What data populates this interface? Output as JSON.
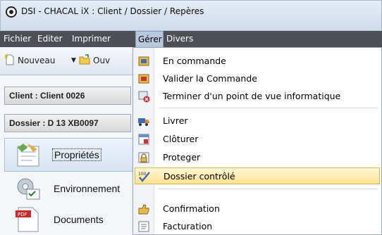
{
  "window": {
    "title": "DSI - CHACAL iX : Client / Dossier / Repères"
  },
  "menubar": {
    "items": [
      {
        "label": "Fichier"
      },
      {
        "label": "Editer"
      },
      {
        "label": "Imprimer"
      },
      {
        "label": "Gérer"
      },
      {
        "label": "Divers"
      }
    ],
    "active": "Gérer"
  },
  "toolbar": {
    "new_label": "Nouveau",
    "open_label": "Ouv"
  },
  "left": {
    "client_label": "Client : Client 0026",
    "dossier_label": "Dossier : D 13 XB0097",
    "nav": [
      {
        "label": "Propriétés",
        "icon": "properties-icon",
        "selected": true
      },
      {
        "label": "Environnement",
        "icon": "environment-icon"
      },
      {
        "label": "Documents",
        "icon": "pdf-document-icon"
      }
    ]
  },
  "dropdown": {
    "items": [
      {
        "label": "En commande",
        "icon": "order-icon"
      },
      {
        "label": "Valider la Commande",
        "icon": "validate-order-icon"
      },
      {
        "label": "Terminer d'un point de vue informatique",
        "icon": "finish-it-icon"
      },
      {
        "label": "Livrer",
        "icon": "delivery-truck-icon"
      },
      {
        "label": "Clôturer",
        "icon": "close-calendar-icon"
      },
      {
        "label": "Proteger",
        "icon": "lock-icon"
      },
      {
        "label": "Dossier contrôlé",
        "icon": "checked-100-icon",
        "highlighted": true
      },
      {
        "label": "Confirmation",
        "icon": "confirmation-icon"
      },
      {
        "label": "Facturation",
        "icon": "invoice-icon"
      }
    ]
  },
  "colors": {
    "menubar": "#4c4f54",
    "highlight": "#ffe38f",
    "titlebar": "#dbe6f3"
  }
}
